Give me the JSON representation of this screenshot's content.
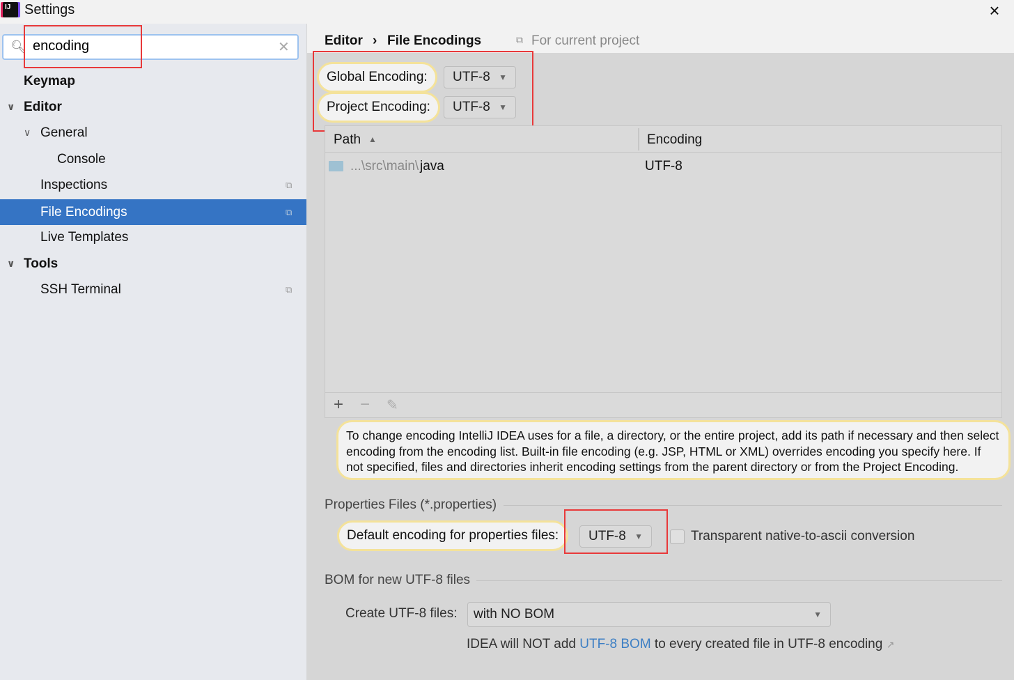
{
  "window": {
    "title": "Settings",
    "close_icon": "×"
  },
  "search": {
    "value": "encoding"
  },
  "tree": [
    {
      "label": "Keymap"
    },
    {
      "label": "Editor"
    },
    {
      "label": "General"
    },
    {
      "label": "Console"
    },
    {
      "label": "Inspections"
    },
    {
      "label": "File Encodings"
    },
    {
      "label": "Live Templates"
    },
    {
      "label": "Tools"
    },
    {
      "label": "SSH Terminal"
    }
  ],
  "breadcrumb": {
    "parent": "Editor",
    "separator": "›",
    "current": "File Encodings",
    "scope": "For current project"
  },
  "global_encoding": {
    "label": "Global Encoding:",
    "value": "UTF-8"
  },
  "project_encoding": {
    "label": "Project Encoding:",
    "value": "UTF-8"
  },
  "table": {
    "columns": [
      "Path",
      "Encoding"
    ],
    "rows": [
      {
        "path_prefix": "...\\src\\main\\",
        "path_leaf": "java",
        "encoding": "UTF-8"
      }
    ]
  },
  "info_text": "To change encoding IntelliJ IDEA uses for a file, a directory, or the entire project, add its path if necessary and then select encoding from the encoding list. Built-in file encoding (e.g. JSP, HTML or XML) overrides encoding you specify here. If not specified, files and directories inherit encoding settings from the parent directory or from the Project Encoding.",
  "properties": {
    "section": "Properties Files (*.properties)",
    "label": "Default encoding for properties files:",
    "value": "UTF-8",
    "checkbox_label": "Transparent native-to-ascii conversion",
    "checked": false
  },
  "bom": {
    "section": "BOM for new UTF-8 files",
    "label": "Create UTF-8 files:",
    "value": "with NO BOM",
    "note_prefix": "IDEA will NOT add ",
    "note_link": "UTF-8 BOM",
    "note_suffix": " to every created file in UTF-8 encoding"
  },
  "colors": {
    "selection": "#3574c4",
    "highlight": "#e8393a",
    "bubble": "#f4e29a",
    "link": "#3d7fc4"
  }
}
